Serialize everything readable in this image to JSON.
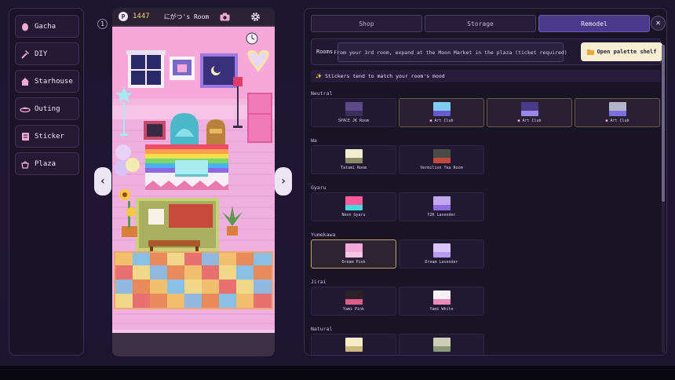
{
  "menu": [
    {
      "label": "Gacha",
      "icon": "egg-icon"
    },
    {
      "label": "DIY",
      "icon": "hammer-icon"
    },
    {
      "label": "Starhouse",
      "icon": "house-icon"
    },
    {
      "label": "Outing",
      "icon": "ufo-icon"
    },
    {
      "label": "Sticker",
      "icon": "sticker-icon"
    },
    {
      "label": "Plaza",
      "icon": "shop-icon"
    }
  ],
  "room": {
    "number": "1",
    "points": "1447",
    "title": "にがつ's Room"
  },
  "tabs": [
    "Shop",
    "Storage",
    "Remodel"
  ],
  "active_tab": "Remodel",
  "rooms_label": "Rooms",
  "rooms_info": "From your 3rd room, expand at the Moon Market in the plaza (ticket required)",
  "palette_button": "Open palette shelf",
  "tip": "Stickers tend to match your room's mood",
  "categories": [
    {
      "name": "Neutral",
      "items": [
        {
          "label": "SPACE JK Room",
          "owned": false,
          "top": "#5a4a8a",
          "bottom": "#3a2f5c"
        },
        {
          "label": "Art Club",
          "owned": true,
          "top": "#7fcdf2",
          "bottom": "#6a5ad0"
        },
        {
          "label": "Art Club",
          "owned": true,
          "top": "#4a3a8c",
          "bottom": "#9a88e6"
        },
        {
          "label": "Art Club",
          "owned": true,
          "top": "#b4b4c8",
          "bottom": "#7c70e0"
        }
      ]
    },
    {
      "name": "Wa",
      "items": [
        {
          "label": "Tatami Room",
          "owned": false,
          "top": "#f0ecd0",
          "bottom": "#8a8a6a"
        },
        {
          "label": "Vermilion Tea Room",
          "owned": false,
          "top": "#4a4a48",
          "bottom": "#c24a3a"
        }
      ]
    },
    {
      "name": "Gyaru",
      "items": [
        {
          "label": "Neon Gyaru",
          "owned": false,
          "top": "#ff5a9a",
          "bottom": "#4ad8e0"
        },
        {
          "label": "Y2K Lavender",
          "owned": false,
          "top": "#c0a8f0",
          "bottom": "#8f6ae0"
        }
      ]
    },
    {
      "name": "Yumekawa",
      "items": [
        {
          "label": "Dream Pink",
          "owned": false,
          "selected": true,
          "top": "#f6a8d8",
          "bottom": "#f7c6e4"
        },
        {
          "label": "Dream Lavender",
          "owned": false,
          "top": "#d8c4f6",
          "bottom": "#b89aee"
        }
      ]
    },
    {
      "name": "Jirai",
      "items": [
        {
          "label": "Yami Pink",
          "owned": false,
          "top": "#2a2228",
          "bottom": "#e05a8a"
        },
        {
          "label": "Yami White",
          "owned": false,
          "top": "#f4f0f6",
          "bottom": "#f08ab8"
        }
      ]
    },
    {
      "name": "Natural",
      "items": [
        {
          "label": "",
          "owned": false,
          "top": "#f4ecc4",
          "bottom": "#c8b880"
        },
        {
          "label": "",
          "owned": false,
          "top": "#cfcfb8",
          "bottom": "#8a9a78"
        }
      ]
    }
  ]
}
